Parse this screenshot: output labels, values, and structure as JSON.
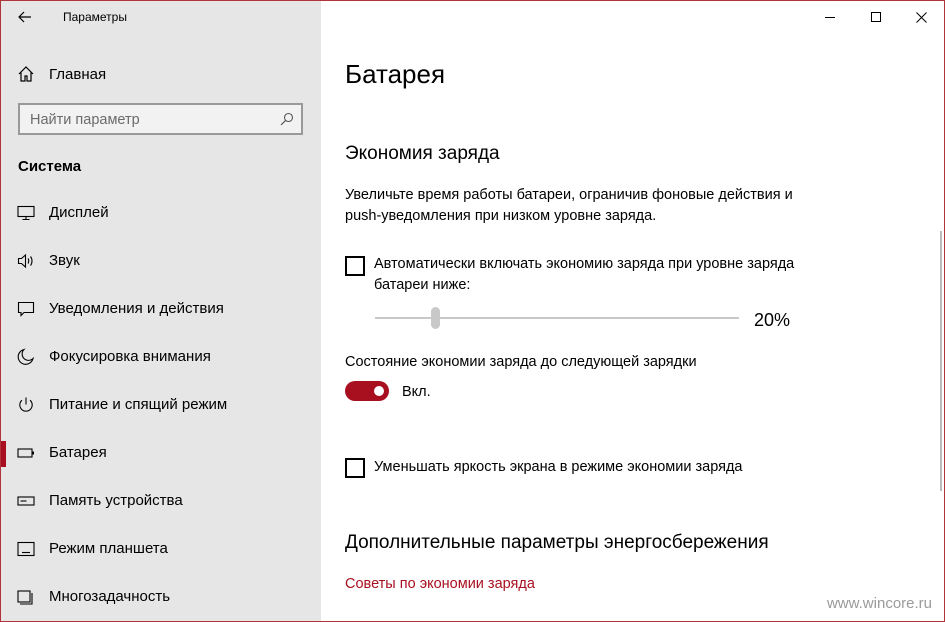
{
  "window": {
    "title": "Параметры",
    "accent": "#a8101f",
    "border_color": "#b0353a"
  },
  "sidebar": {
    "home_label": "Главная",
    "search_placeholder": "Найти параметр",
    "section_title": "Система",
    "items": [
      {
        "label": "Дисплей",
        "icon": "display-icon"
      },
      {
        "label": "Звук",
        "icon": "speaker-icon"
      },
      {
        "label": "Уведомления и действия",
        "icon": "notification-icon"
      },
      {
        "label": "Фокусировка внимания",
        "icon": "moon-icon"
      },
      {
        "label": "Питание и спящий режим",
        "icon": "power-icon"
      },
      {
        "label": "Батарея",
        "icon": "battery-icon",
        "active": true
      },
      {
        "label": "Память устройства",
        "icon": "storage-icon"
      },
      {
        "label": "Режим планшета",
        "icon": "tablet-icon"
      },
      {
        "label": "Многозадачность",
        "icon": "multitask-icon"
      }
    ]
  },
  "content": {
    "page_title": "Батарея",
    "saver_heading": "Экономия заряда",
    "saver_description": "Увеличьте время работы батареи, ограничив фоновые действия и push-уведомления при низком уровне заряда.",
    "auto_checkbox_label": "Автоматически включать экономию заряда при уровне заряда батареи ниже:",
    "auto_checkbox_checked": false,
    "threshold_value": "20%",
    "threshold_fraction": 0.2,
    "state_label": "Состояние экономии заряда до следующей зарядки",
    "toggle_on": true,
    "toggle_label": "Вкл.",
    "brightness_checkbox_label": "Уменьшать яркость экрана в режиме экономии заряда",
    "brightness_checkbox_checked": false,
    "more_heading": "Дополнительные параметры энергосбережения",
    "link_tips": "Советы по экономии заряда"
  },
  "watermark": "www.wincore.ru"
}
